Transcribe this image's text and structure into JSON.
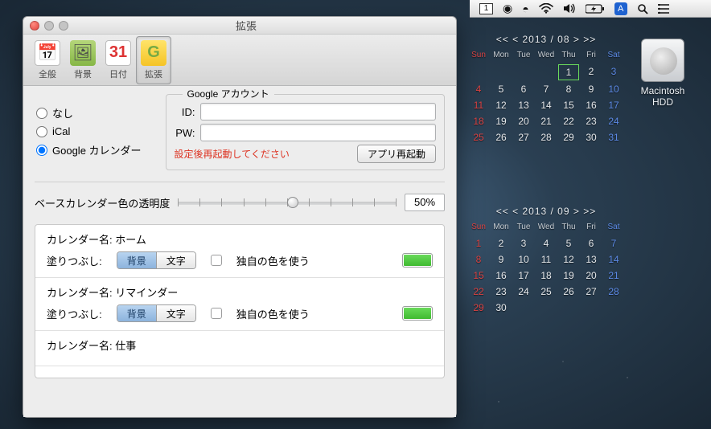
{
  "menubar": {
    "date_box": "1",
    "blue_letter": "A"
  },
  "desktop": {
    "hdd_label": "Macintosh HDD"
  },
  "calendars": [
    {
      "header": "<<  <   2013 / 08   >  >>",
      "dow": [
        "Sun",
        "Mon",
        "Tue",
        "Wed",
        "Thu",
        "Fri",
        "Sat"
      ],
      "today": 1,
      "weeks": [
        [
          "",
          "",
          "",
          "",
          1,
          2,
          3
        ],
        [
          4,
          5,
          6,
          7,
          8,
          9,
          10
        ],
        [
          11,
          12,
          13,
          14,
          15,
          16,
          17
        ],
        [
          18,
          19,
          20,
          21,
          22,
          23,
          24
        ],
        [
          25,
          26,
          27,
          28,
          29,
          30,
          31
        ]
      ]
    },
    {
      "header": "<<  <   2013 / 09   >  >>",
      "dow": [
        "Sun",
        "Mon",
        "Tue",
        "Wed",
        "Thu",
        "Fri",
        "Sat"
      ],
      "today": null,
      "weeks": [
        [
          1,
          2,
          3,
          4,
          5,
          6,
          7
        ],
        [
          8,
          9,
          10,
          11,
          12,
          13,
          14
        ],
        [
          15,
          16,
          17,
          18,
          19,
          20,
          21
        ],
        [
          22,
          23,
          24,
          25,
          26,
          27,
          28
        ],
        [
          29,
          30,
          "",
          "",
          "",
          "",
          ""
        ]
      ]
    }
  ],
  "window": {
    "title": "拡張",
    "toolbar": {
      "general": "全般",
      "background": "背景",
      "date": "日付",
      "extension": "拡張",
      "date_num": "31",
      "ext_letter": "G"
    },
    "radios": {
      "none": "なし",
      "ical": "iCal",
      "google": "Google カレンダー"
    },
    "account": {
      "title": "Google アカウント",
      "id_label": "ID:",
      "pw_label": "PW:",
      "warn": "設定後再起動してください",
      "restart": "アプリ再起動",
      "id_value": "",
      "pw_value": ""
    },
    "opacity": {
      "label": "ベースカレンダー色の透明度",
      "value": "50%"
    },
    "cal_label": "カレンダー名:",
    "fill_label": "塗りつぶし:",
    "seg_bg": "背景",
    "seg_text": "文字",
    "owncolor": "独自の色を使う",
    "cals": [
      {
        "name": "ホーム"
      },
      {
        "name": "リマインダー"
      },
      {
        "name": "仕事"
      }
    ]
  }
}
